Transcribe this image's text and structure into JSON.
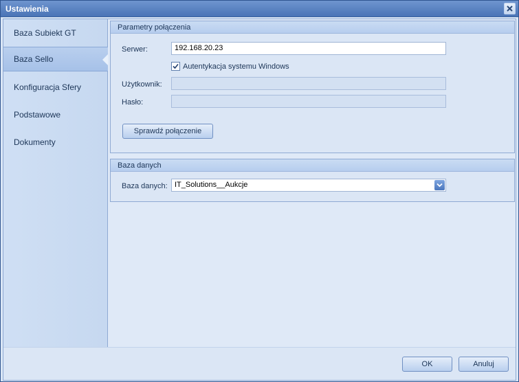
{
  "window": {
    "title": "Ustawienia"
  },
  "sidebar": {
    "items": [
      {
        "label": "Baza Subiekt GT"
      },
      {
        "label": "Baza Sello"
      },
      {
        "label": "Konfiguracja Sfery"
      },
      {
        "label": "Podstawowe"
      },
      {
        "label": "Dokumenty"
      }
    ],
    "active_index": 1
  },
  "connection": {
    "header": "Parametry połączenia",
    "server_label": "Serwer:",
    "server_value": "192.168.20.23",
    "windows_auth_label": "Autentykacja systemu Windows",
    "windows_auth_checked": true,
    "user_label": "Użytkownik:",
    "user_value": "",
    "password_label": "Hasło:",
    "password_value": "",
    "test_button": "Sprawdź połączenie"
  },
  "database": {
    "header": "Baza danych",
    "db_label": "Baza danych:",
    "db_value": "IT_Solutions__Aukcje"
  },
  "footer": {
    "ok_label": "OK",
    "cancel_label": "Anuluj"
  },
  "icons": {
    "close": "close-icon",
    "check": "checkmark-icon",
    "dropdown": "chevron-down-icon"
  },
  "colors": {
    "titlebar": "#4a74b6",
    "accent": "#4a76bd"
  }
}
